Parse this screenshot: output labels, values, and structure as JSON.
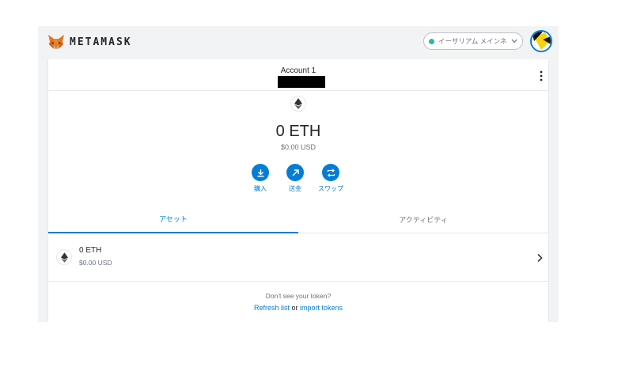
{
  "header": {
    "logo_text": "METAMASK",
    "network_label": "イーサリアム メインネット",
    "network_dot_color": "#29b6af"
  },
  "account": {
    "name": "Account 1",
    "address": "redacted"
  },
  "balance": {
    "amount": "0 ETH",
    "fiat": "$0.00 USD"
  },
  "actions": [
    {
      "label": "購入",
      "icon": "download-icon"
    },
    {
      "label": "送金",
      "icon": "arrow-up-right-icon"
    },
    {
      "label": "スワップ",
      "icon": "swap-icon"
    }
  ],
  "tabs": [
    {
      "label": "アセット",
      "active": true
    },
    {
      "label": "アクティビティ",
      "active": false
    }
  ],
  "assets": [
    {
      "amount": "0 ETH",
      "fiat": "$0.00 USD",
      "icon": "ethereum-icon"
    }
  ],
  "token_prompt": {
    "question": "Don't see your token?",
    "refresh": "Refresh list",
    "or": "or",
    "import": "import tokens"
  },
  "colors": {
    "accent": "#037dd6",
    "background": "#f2f3f4"
  }
}
